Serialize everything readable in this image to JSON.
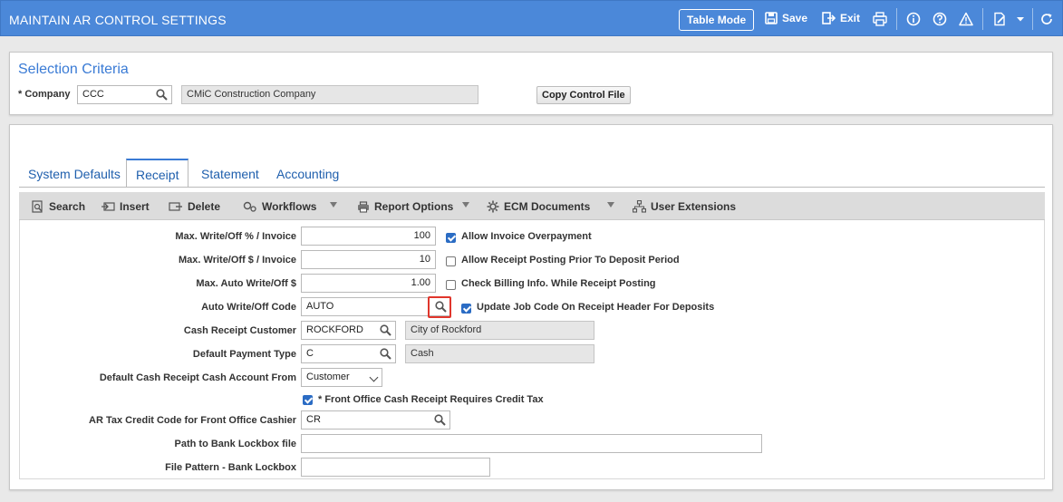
{
  "app": {
    "title": "MAINTAIN AR CONTROL SETTINGS",
    "table_mode_label": "Table Mode",
    "save_label": "Save",
    "exit_label": "Exit"
  },
  "selection": {
    "title": "Selection Criteria",
    "company_label": "Company",
    "company_required": "*",
    "company_value": "CCC",
    "company_name": "CMiC Construction Company",
    "copy_button_label": "Copy Control File"
  },
  "tabs": [
    {
      "label": "System Defaults",
      "active": false
    },
    {
      "label": "Receipt",
      "active": true
    },
    {
      "label": "Statement",
      "active": false
    },
    {
      "label": "Accounting",
      "active": false
    }
  ],
  "toolbar": {
    "search": "Search",
    "insert": "Insert",
    "delete": "Delete",
    "workflows": "Workflows",
    "report_options": "Report Options",
    "ecm_documents": "ECM Documents",
    "user_extensions": "User Extensions"
  },
  "form": {
    "max_writeoff_pct_label": "Max. Write/Off % / Invoice",
    "max_writeoff_pct_value": "100",
    "max_writeoff_amt_label": "Max. Write/Off $ / Invoice",
    "max_writeoff_amt_value": "10",
    "max_auto_writeoff_label": "Max. Auto Write/Off $",
    "max_auto_writeoff_value": "1.00",
    "auto_writeoff_code_label": "Auto Write/Off Code",
    "auto_writeoff_code_value": "AUTO",
    "cash_receipt_customer_label": "Cash Receipt Customer",
    "cash_receipt_customer_value": "ROCKFORD",
    "cash_receipt_customer_name": "City of Rockford",
    "default_payment_type_label": "Default Payment Type",
    "default_payment_type_value": "C",
    "default_payment_type_name": "Cash",
    "default_cash_account_label": "Default Cash Receipt Cash Account From",
    "default_cash_account_value": "Customer",
    "front_office_credit_tax_label": "* Front Office Cash Receipt Requires Credit Tax",
    "ar_tax_credit_label": "AR Tax Credit Code for Front Office Cashier",
    "ar_tax_credit_value": "CR",
    "lockbox_path_label": "Path to Bank Lockbox file",
    "lockbox_path_value": "",
    "lockbox_pattern_label": "File Pattern - Bank Lockbox",
    "lockbox_pattern_value": ""
  },
  "checkboxes": {
    "allow_invoice_overpayment": {
      "label": "Allow Invoice Overpayment",
      "checked": true
    },
    "allow_receipt_posting_prior": {
      "label": "Allow Receipt Posting Prior To Deposit Period",
      "checked": false
    },
    "check_billing_info": {
      "label": "Check Billing Info. While Receipt Posting",
      "checked": false
    },
    "update_job_code": {
      "label": "Update Job Code On Receipt Header For Deposits",
      "checked": true
    },
    "front_office_credit_tax": {
      "checked": true
    }
  },
  "colors": {
    "topbar": "#4b88d9",
    "accent": "#3a7bd5",
    "highlight": "#e0362c"
  }
}
